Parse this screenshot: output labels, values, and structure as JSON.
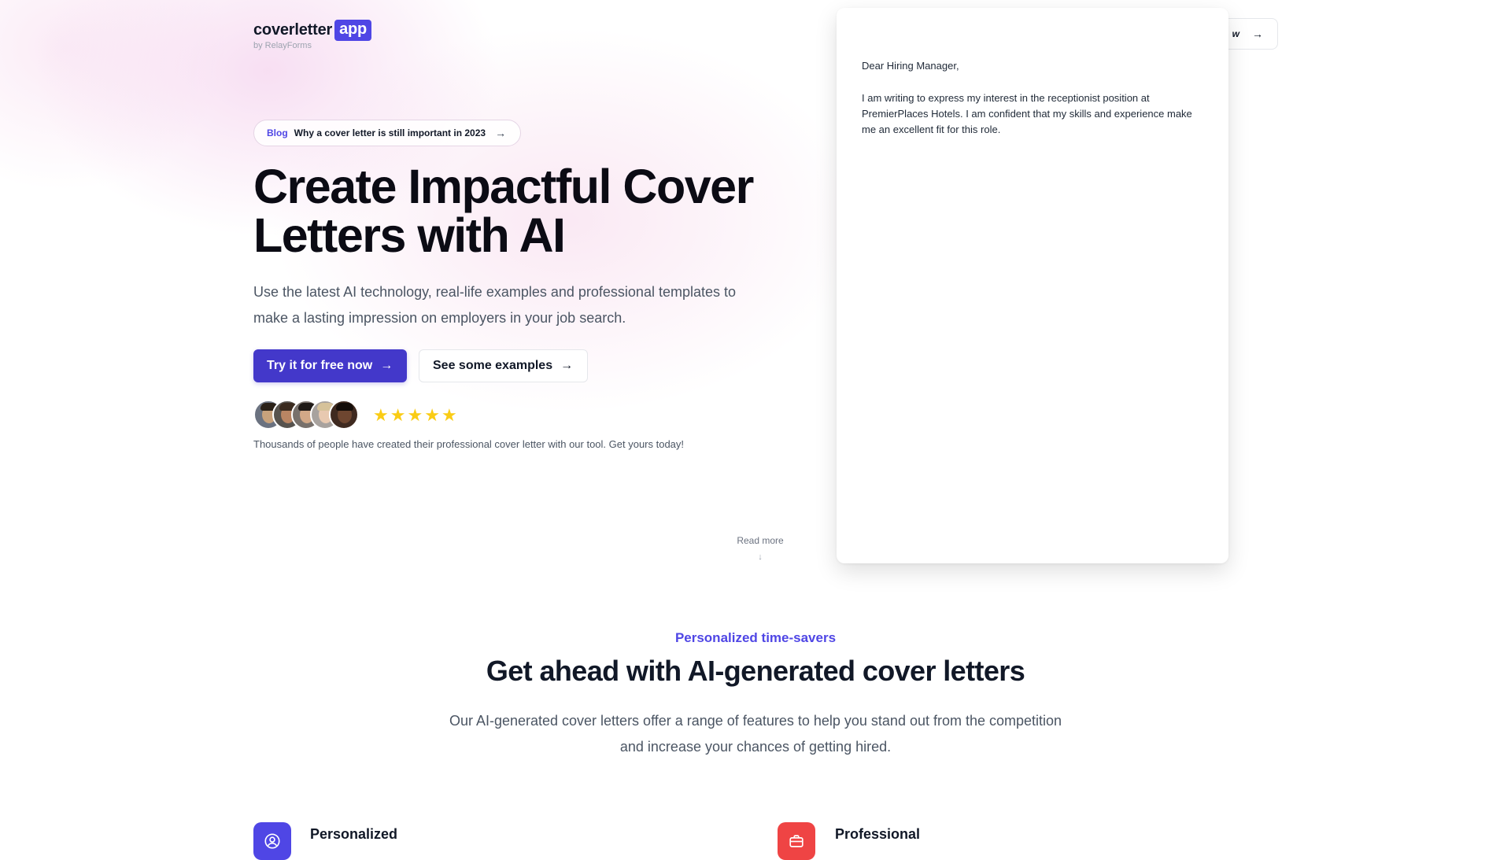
{
  "logo": {
    "name": "coverletter",
    "badge": "app",
    "byline": "by RelayForms"
  },
  "nav": {
    "cta_partial_label": "w"
  },
  "blog_pill": {
    "tag": "Blog",
    "text": "Why a cover letter is still important in 2023"
  },
  "hero": {
    "title": "Create Impactful Cover Letters with AI",
    "description": "Use the latest AI technology, real-life examples and professional templates to make a lasting impression on employers in your job search.",
    "primary_cta": "Try it for free now",
    "secondary_cta": "See some examples",
    "rating_stars": 5,
    "social_proof": "Thousands of people have created their professional cover letter with our tool. Get yours today!"
  },
  "read_more": {
    "label": "Read more",
    "arrow": "↓"
  },
  "letter": {
    "greeting": "Dear Hiring Manager,",
    "body": "I am writing to express my interest in the receptionist position at PremierPlaces Hotels. I am confident that my skills and experience make me an excellent fit for this role."
  },
  "features_section": {
    "kicker": "Personalized time-savers",
    "title": "Get ahead with AI-generated cover letters",
    "description": "Our AI-generated cover letters offer a range of features to help you stand out from the competition and increase your chances of getting hired.",
    "features": [
      {
        "title": "Personalized",
        "icon": "user-circle-icon",
        "color": "#4f46e5"
      },
      {
        "title": "Professional",
        "icon": "briefcase-icon",
        "color": "#ef4444"
      }
    ]
  },
  "colors": {
    "accent": "#4f46e5",
    "primary_button": "#4338ca",
    "star": "#facc15"
  }
}
